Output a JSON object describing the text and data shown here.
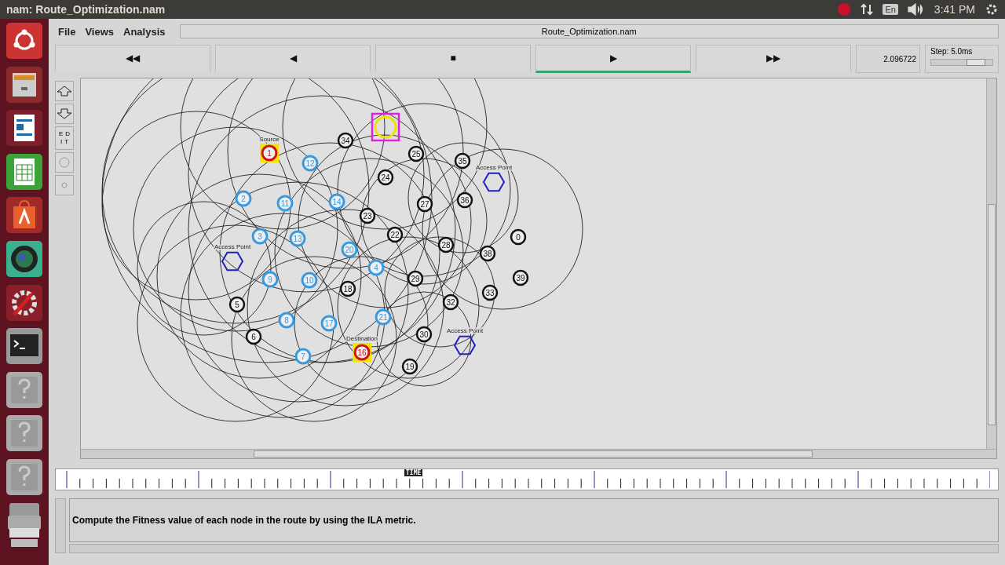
{
  "top_panel": {
    "title": "nam: Route_Optimization.nam",
    "keyboard": "En",
    "clock": "3:41 PM"
  },
  "menu": [
    {
      "label": "File"
    },
    {
      "label": "Views"
    },
    {
      "label": "Analysis"
    }
  ],
  "window_title": "Route_Optimization.nam",
  "playback": [
    {
      "symbol": "◀◀",
      "selected": false
    },
    {
      "symbol": "◀",
      "selected": false
    },
    {
      "symbol": "■",
      "selected": false
    },
    {
      "symbol": "▶",
      "selected": true
    },
    {
      "symbol": "▶▶",
      "selected": false
    }
  ],
  "time": "2.096722",
  "step": {
    "label": "Step: 5.0ms",
    "level": 0.72
  },
  "edit_tool": "EDIT",
  "nodes": [
    {
      "kind": "router"
    },
    {
      "label": "34",
      "kind": "plain"
    },
    {
      "label": "1",
      "kind": "source",
      "caption": "Source"
    },
    {
      "label": "25",
      "kind": "plain"
    },
    {
      "label": "12",
      "kind": "mobile"
    },
    {
      "label": "35",
      "kind": "plain"
    },
    {
      "label": "24",
      "kind": "plain"
    },
    {
      "kind": "access_point",
      "caption": "Access Point"
    },
    {
      "label": "2",
      "kind": "mobile"
    },
    {
      "label": "11",
      "kind": "mobile"
    },
    {
      "label": "14",
      "kind": "mobile"
    },
    {
      "label": "27",
      "kind": "plain"
    },
    {
      "label": "36",
      "kind": "plain"
    },
    {
      "label": "23",
      "kind": "plain"
    },
    {
      "label": "3",
      "kind": "mobile"
    },
    {
      "label": "13",
      "kind": "mobile"
    },
    {
      "label": "22",
      "kind": "plain"
    },
    {
      "label": "0",
      "kind": "plain"
    },
    {
      "label": "20",
      "kind": "mobile"
    },
    {
      "label": "28",
      "kind": "plain"
    },
    {
      "label": "38",
      "kind": "plain"
    },
    {
      "kind": "access_point",
      "caption": "Access Point"
    },
    {
      "label": "4",
      "kind": "mobile"
    },
    {
      "label": "9",
      "kind": "mobile"
    },
    {
      "label": "10",
      "kind": "mobile"
    },
    {
      "label": "29",
      "kind": "plain"
    },
    {
      "label": "39",
      "kind": "plain"
    },
    {
      "label": "18",
      "kind": "plain"
    },
    {
      "label": "33",
      "kind": "plain"
    },
    {
      "label": "5",
      "kind": "plain"
    },
    {
      "label": "32",
      "kind": "plain"
    },
    {
      "label": "8",
      "kind": "mobile"
    },
    {
      "label": "17",
      "kind": "mobile"
    },
    {
      "label": "21",
      "kind": "mobile"
    },
    {
      "label": "6",
      "kind": "plain"
    },
    {
      "label": "30",
      "kind": "plain"
    },
    {
      "kind": "access_point",
      "caption": "Access Point"
    },
    {
      "label": "7",
      "kind": "mobile"
    },
    {
      "label": "16",
      "kind": "destination",
      "caption": "Destination"
    },
    {
      "label": "19",
      "kind": "plain"
    }
  ],
  "timeline": {
    "marker": "TIME",
    "level": 0.37
  },
  "message": "Compute the Fitness value of each node in the route by using the ILA metric."
}
